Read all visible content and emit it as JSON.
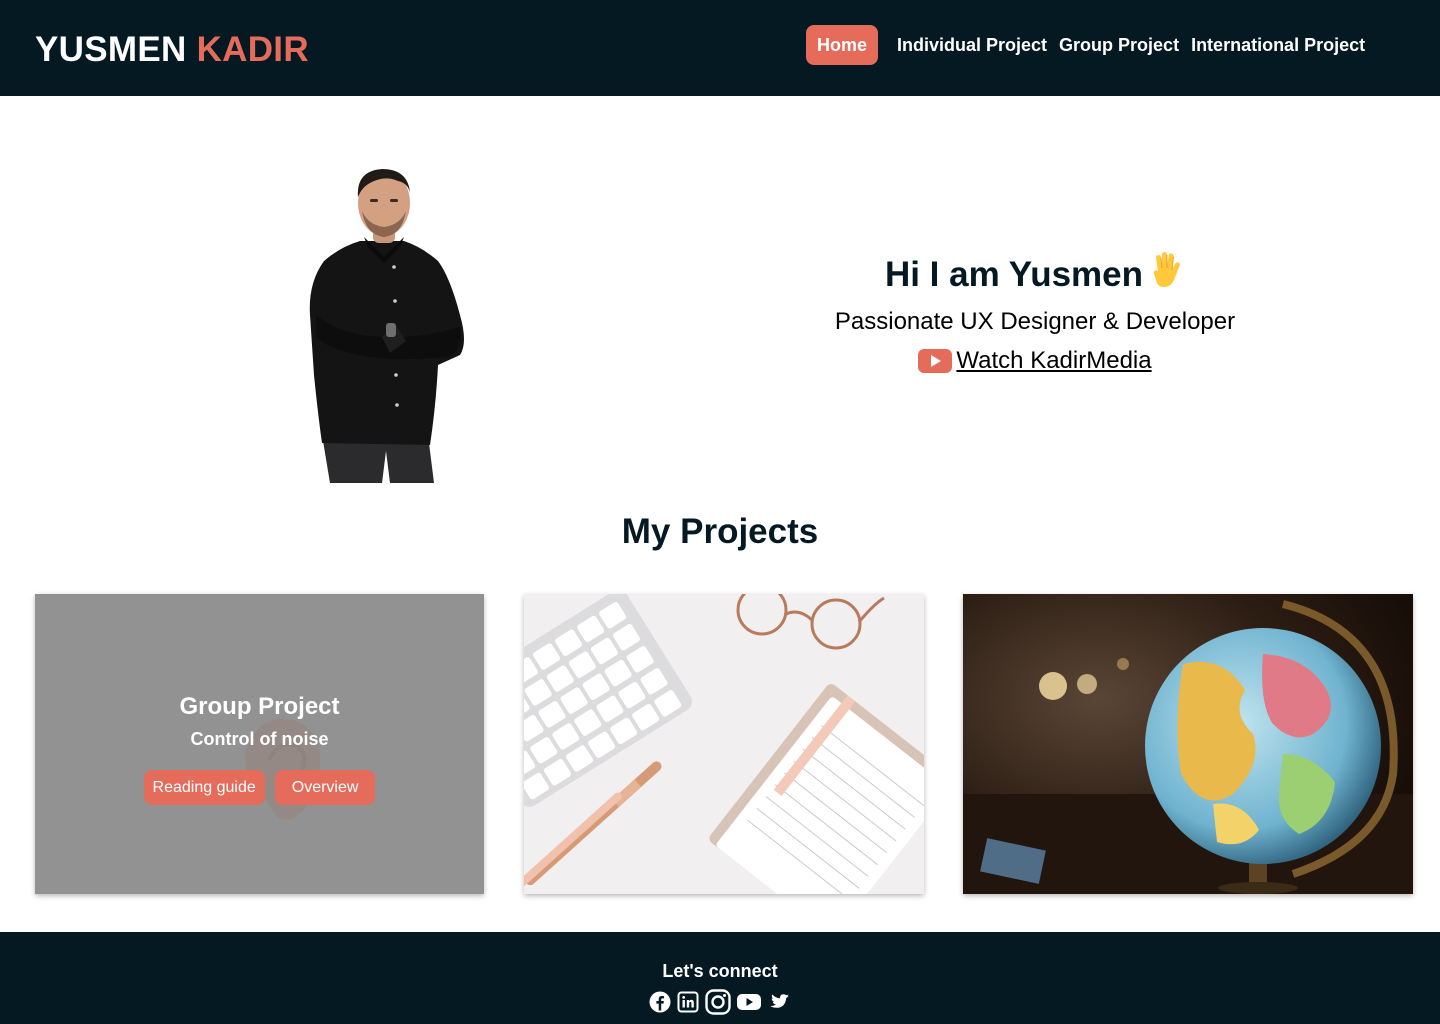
{
  "header": {
    "logo_first": "YUSMEN",
    "logo_second": "KADIR",
    "nav": [
      {
        "label": "Home",
        "active": true
      },
      {
        "label": "Individual Project",
        "active": false
      },
      {
        "label": "Group Project",
        "active": false
      },
      {
        "label": "International Project",
        "active": false
      }
    ]
  },
  "hero": {
    "greeting": "Hi I am Yusmen",
    "greeting_icon": "raised-hand-emoji",
    "subtitle": "Passionate UX Designer & Developer",
    "link_icon": "youtube-icon",
    "link_label": "Watch KadirMedia"
  },
  "projects": {
    "title": "My Projects",
    "cards": [
      {
        "image": "ear-photo",
        "title": "Group Project",
        "subtitle": "Control of noise",
        "buttons": [
          "Reading guide",
          "Overview"
        ]
      },
      {
        "image": "desk-keyboard-notebook-photo"
      },
      {
        "image": "globe-photo"
      }
    ]
  },
  "footer": {
    "title": "Let's connect",
    "socials": [
      "facebook-icon",
      "linkedin-icon",
      "instagram-icon",
      "youtube-icon",
      "twitter-icon"
    ]
  },
  "colors": {
    "navy": "#051923",
    "accent": "#e56b5a",
    "white": "#ffffff"
  }
}
